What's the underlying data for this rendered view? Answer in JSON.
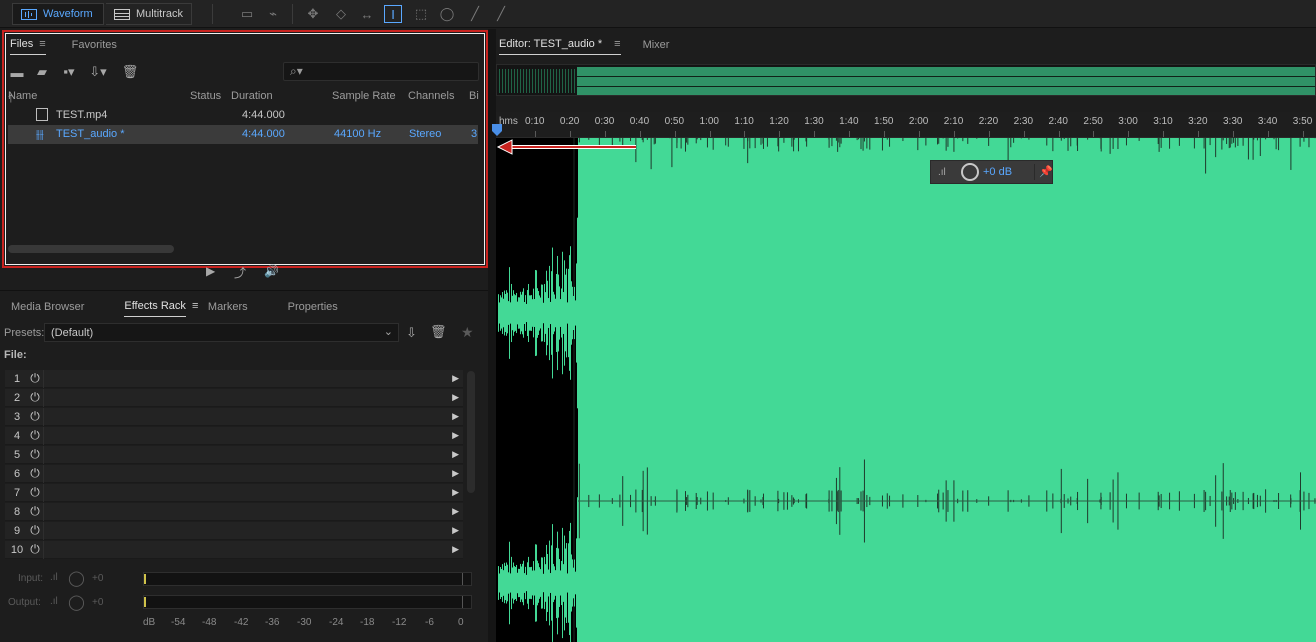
{
  "workspace": {
    "waveform_label": "Waveform",
    "multitrack_label": "Multitrack"
  },
  "files_panel": {
    "tab_files": "Files",
    "tab_favorites": "Favorites",
    "columns": [
      "Name",
      "Status",
      "Duration",
      "Sample Rate",
      "Channels",
      "Bi"
    ],
    "rows": [
      {
        "name": "TEST.mp4",
        "status": "",
        "duration": "4:44.000",
        "sample_rate": "",
        "channels": "",
        "bits": "",
        "icon": "video-file-icon",
        "selected": false
      },
      {
        "name": "TEST_audio *",
        "status": "",
        "duration": "4:44.000",
        "sample_rate": "44100 Hz",
        "channels": "Stereo",
        "bits": "3",
        "icon": "audio-waveform-icon",
        "selected": true
      }
    ],
    "search_placeholder": ""
  },
  "effects_panel": {
    "tabs": [
      "Media Browser",
      "Effects Rack",
      "Markers",
      "Properties"
    ],
    "active_tab": "Effects Rack",
    "presets_label": "Presets:",
    "presets_value": "(Default)",
    "file_label": "File:",
    "rack_slots": [
      "1",
      "2",
      "3",
      "4",
      "5",
      "6",
      "7",
      "8",
      "9",
      "10"
    ],
    "input_label": "Input:",
    "input_value": "+0",
    "output_label": "Output:",
    "output_value": "+0",
    "db_scale": [
      "dB",
      "-54",
      "-48",
      "-42",
      "-36",
      "-30",
      "-24",
      "-18",
      "-12",
      "-6",
      "0"
    ]
  },
  "editor": {
    "tab_label": "Editor: TEST_audio *",
    "mixer_label": "Mixer",
    "ruler_unit": "hms",
    "ruler_labels": [
      "0:10",
      "0:20",
      "0:30",
      "0:40",
      "0:50",
      "1:00",
      "1:10",
      "1:20",
      "1:30",
      "1:40",
      "1:50",
      "2:00",
      "2:10",
      "2:20",
      "2:30",
      "2:40",
      "2:50",
      "3:00",
      "3:10",
      "3:20",
      "3:30",
      "3:40",
      "3:50"
    ],
    "gain_hud_value": "+0 dB"
  },
  "colors": {
    "accent": "#5aa8ff",
    "waveform": "#43d996",
    "highlight_border": "#c9231f"
  }
}
